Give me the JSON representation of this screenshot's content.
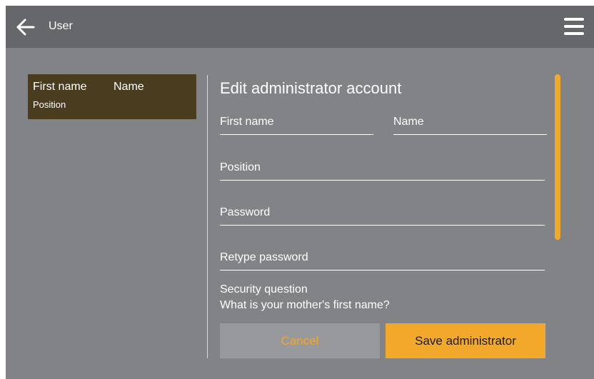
{
  "header": {
    "title": "User",
    "back_icon": "arrow-left-icon",
    "menu_icon": "hamburger-menu-icon"
  },
  "user_list": {
    "items": [
      {
        "first_name": "First name",
        "name": "Name",
        "position": "Position"
      }
    ]
  },
  "form": {
    "title": "Edit administrator account",
    "fields": {
      "first_name": {
        "label": "First name",
        "value": ""
      },
      "name": {
        "label": "Name",
        "value": ""
      },
      "position": {
        "label": "Position",
        "value": ""
      },
      "password": {
        "label": "Password",
        "value": ""
      },
      "retype_password": {
        "label": "Retype password",
        "value": ""
      }
    },
    "security": {
      "label": "Security question",
      "question": "What is your mother's first name?"
    },
    "buttons": {
      "cancel": "Cancel",
      "save": "Save administrator"
    }
  },
  "colors": {
    "background": "#828386",
    "topbar": "#66676a",
    "accent": "#f2a92b",
    "selected_item": "#4a3d1f",
    "cancel_button": "#98999c"
  }
}
